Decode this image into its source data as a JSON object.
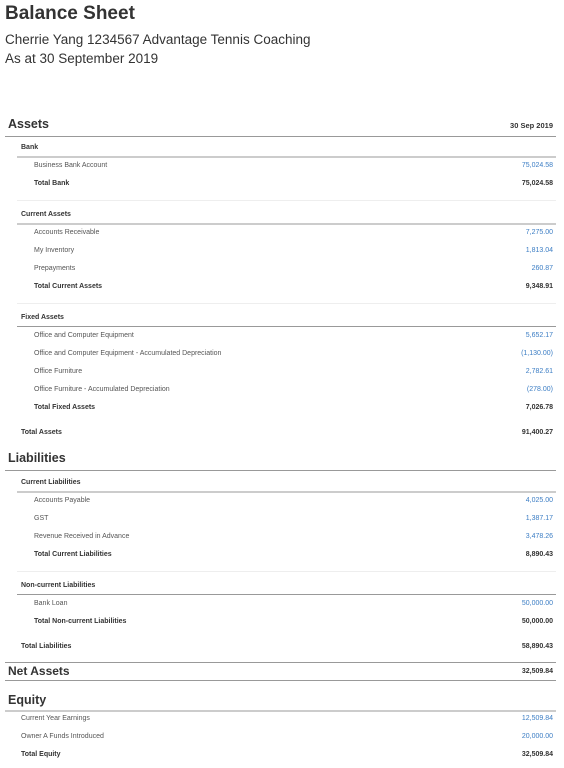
{
  "header": {
    "title": "Balance Sheet",
    "organisation": "Cherrie Yang 1234567 Advantage Tennis Coaching",
    "as_at": "As at 30 September 2019"
  },
  "column_date": "30 Sep 2019",
  "assets": {
    "label": "Assets",
    "bank": {
      "label": "Bank",
      "rows": [
        {
          "label": "Business Bank Account",
          "value": "75,024.58"
        }
      ],
      "total": {
        "label": "Total Bank",
        "value": "75,024.58"
      }
    },
    "current": {
      "label": "Current Assets",
      "rows": [
        {
          "label": "Accounts Receivable",
          "value": "7,275.00"
        },
        {
          "label": "My Inventory",
          "value": "1,813.04"
        },
        {
          "label": "Prepayments",
          "value": "260.87"
        }
      ],
      "total": {
        "label": "Total Current Assets",
        "value": "9,348.91"
      }
    },
    "fixed": {
      "label": "Fixed Assets",
      "rows": [
        {
          "label": "Office and Computer Equipment",
          "value": "5,652.17"
        },
        {
          "label": "Office and Computer Equipment - Accumulated Depreciation",
          "value": "(1,130.00)"
        },
        {
          "label": "Office Furniture",
          "value": "2,782.61"
        },
        {
          "label": "Office Furniture - Accumulated Depreciation",
          "value": "(278.00)"
        }
      ],
      "total": {
        "label": "Total Fixed Assets",
        "value": "7,026.78"
      }
    },
    "total": {
      "label": "Total Assets",
      "value": "91,400.27"
    }
  },
  "liabilities": {
    "label": "Liabilities",
    "current": {
      "label": "Current Liabilities",
      "rows": [
        {
          "label": "Accounts Payable",
          "value": "4,025.00"
        },
        {
          "label": "GST",
          "value": "1,387.17"
        },
        {
          "label": "Revenue Received in Advance",
          "value": "3,478.26"
        }
      ],
      "total": {
        "label": "Total Current Liabilities",
        "value": "8,890.43"
      }
    },
    "noncurrent": {
      "label": "Non-current Liabilities",
      "rows": [
        {
          "label": "Bank Loan",
          "value": "50,000.00"
        }
      ],
      "total": {
        "label": "Total Non-current Liabilities",
        "value": "50,000.00"
      }
    },
    "total": {
      "label": "Total Liabilities",
      "value": "58,890.43"
    }
  },
  "net_assets": {
    "label": "Net Assets",
    "value": "32,509.84"
  },
  "equity": {
    "label": "Equity",
    "rows": [
      {
        "label": "Current Year Earnings",
        "value": "12,509.84"
      },
      {
        "label": "Owner A Funds Introduced",
        "value": "20,000.00"
      }
    ],
    "total": {
      "label": "Total Equity",
      "value": "32,509.84"
    }
  }
}
